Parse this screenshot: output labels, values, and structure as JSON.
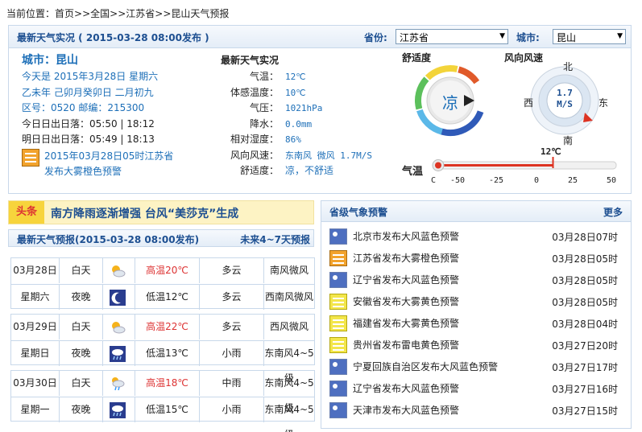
{
  "breadcrumb": {
    "prefix": "当前位置：",
    "home": "首页",
    "sep": ">>",
    "country": "全国",
    "province": "江苏省",
    "page": "昆山天气预报"
  },
  "live": {
    "title": "最新天气实况 ( 2015-03-28 08:00发布 )",
    "province_label": "省份:",
    "province_value": "江苏省",
    "city_label": "城市:",
    "city_value": "昆山",
    "city_name": "城市：昆山",
    "today": "今天是 2015年3月28日 星期六",
    "lunar": "乙未年 己卯月癸卯日 二月初九",
    "codes": "区号：0520  邮编：215300",
    "sun_today": "今日日出日落：05:50 | 18:12",
    "sun_tomorrow": "明日日出日落：05:49 | 18:13",
    "warning": "2015年03月28日05时江苏省发布大雾橙色预警",
    "right_title": "最新天气实况",
    "rows": [
      {
        "k": "气温：",
        "v": "12℃"
      },
      {
        "k": "体感温度：",
        "v": "10℃"
      },
      {
        "k": "气压：",
        "v": "1021hPa"
      },
      {
        "k": "降水：",
        "v": "0.0mm"
      },
      {
        "k": "相对湿度：",
        "v": "86%"
      },
      {
        "k": "风向风速：",
        "v": "东南风 微风 1.7M/S"
      },
      {
        "k": "舒适度：",
        "v": "凉，不舒适"
      }
    ],
    "comfort_title": "舒适度",
    "comfort_value": "凉",
    "wind_title": "风向风速",
    "wind_value": "1.7",
    "wind_unit": "M/S",
    "dirs": {
      "n": "北",
      "s": "南",
      "e": "东",
      "w": "西"
    },
    "temp_title": "气温",
    "temp_current": "12℃",
    "temp_value": 12,
    "temp_ticks": [
      "C",
      "-50",
      "-25",
      "0",
      "25",
      "50"
    ]
  },
  "news": {
    "tag": "头条",
    "text": "南方降雨逐渐增强 台风“美莎克”生成"
  },
  "forecast": {
    "title": "最新天气预报(2015-03-28 08:00发布)",
    "more": "未来4~7天预报",
    "days": [
      {
        "date": "03月28日",
        "week": "星期六",
        "day": {
          "label": "白天",
          "icon": "cloudy-sun-icon",
          "temp": "高温20℃",
          "weather": "多云",
          "wind": "南风微风"
        },
        "night": {
          "label": "夜晚",
          "icon": "moon-icon",
          "temp": "低温12℃",
          "weather": "多云",
          "wind": "西南风微风"
        }
      },
      {
        "date": "03月29日",
        "week": "星期日",
        "day": {
          "label": "白天",
          "icon": "cloudy-sun-icon",
          "temp": "高温22℃",
          "weather": "多云",
          "wind": "西风微风"
        },
        "night": {
          "label": "夜晚",
          "icon": "rain-icon",
          "temp": "低温13℃",
          "weather": "小雨",
          "wind": "东南风4~5级"
        }
      },
      {
        "date": "03月30日",
        "week": "星期一",
        "day": {
          "label": "白天",
          "icon": "rain-cloud-icon",
          "temp": "高温18℃",
          "weather": "中雨",
          "wind": "东南风4~5级"
        },
        "night": {
          "label": "夜晚",
          "icon": "rain-icon",
          "temp": "低温15℃",
          "weather": "小雨",
          "wind": "东南风4~5级"
        }
      }
    ]
  },
  "alerts": {
    "title": "省级气象预警",
    "more": "更多",
    "items": [
      {
        "text": "北京市发布大风蓝色预警",
        "time": "03月28日07时",
        "color": "blue"
      },
      {
        "text": "江苏省发布大雾橙色预警",
        "time": "03月28日05时",
        "color": "orange"
      },
      {
        "text": "辽宁省发布大风蓝色预警",
        "time": "03月28日05时",
        "color": "blue"
      },
      {
        "text": "安徽省发布大雾黄色预警",
        "time": "03月28日05时",
        "color": "yellow"
      },
      {
        "text": "福建省发布大雾黄色预警",
        "time": "03月28日04时",
        "color": "yellow"
      },
      {
        "text": "贵州省发布雷电黄色预警",
        "time": "03月27日20时",
        "color": "yellow"
      },
      {
        "text": "宁夏回族自治区发布大风蓝色预警",
        "time": "03月27日17时",
        "color": "blue"
      },
      {
        "text": "辽宁省发布大风蓝色预警",
        "time": "03月27日16时",
        "color": "blue"
      },
      {
        "text": "天津市发布大风蓝色预警",
        "time": "03月27日15时",
        "color": "blue"
      }
    ]
  }
}
